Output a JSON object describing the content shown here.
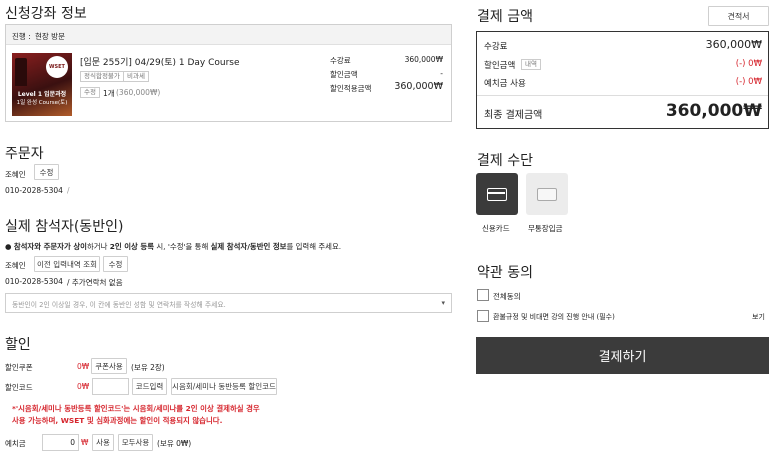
{
  "course_info": {
    "title": "신청강좌 정보",
    "status_label": "진행 :",
    "status_value": "현장 방문",
    "thumb_brand": "WSET",
    "thumb_line1": "Level 1 입문과정",
    "thumb_line2": "1일 완성 Course(토)",
    "course_name": "[입문 255기] 04/29(토) 1 Day Course",
    "tags": [
      "정식합정불가",
      "비과세"
    ],
    "edit_button": "수정",
    "quantity": "1개",
    "quantity_price": "(360,000₩)",
    "fee_label": "수강료",
    "fee_value": "360,000₩",
    "discount_label": "할인금액",
    "discount_value": "-",
    "applied_label": "할인적용금액",
    "applied_value": "360,000₩"
  },
  "orderer": {
    "title": "주문자",
    "name": "조혜인",
    "edit_button": "수정",
    "phone": "010-2028-5304",
    "separator": "/"
  },
  "attendee": {
    "title": "실제 참석자(동반인)",
    "notice_parts": [
      "● ",
      "참석자와 주문자가 상이",
      "하거나 ",
      "2인 이상 등록",
      " 시, '수정'을 통해 ",
      "실제 참석자/동반인 정보",
      "를 입력해 주세요."
    ],
    "name": "조혜인",
    "prev_button": "이전 입력내역 조회",
    "edit_button": "수정",
    "phone": "010-2028-5304",
    "extra_contact": "/  추가연락처 없음",
    "select_placeholder": "동반인이 2인 이상일 경우, 이 칸에 동반인 성함 및 연락처를 작성해 주세요."
  },
  "discount": {
    "title": "할인",
    "coupon_label": "할인쿠폰",
    "coupon_amount": "0₩",
    "coupon_button": "쿠폰사용",
    "coupon_have": "(보유 2장)",
    "code_label": "할인코드",
    "code_amount": "0₩",
    "code_input_value": "",
    "code_button": "코드입력",
    "seminar_button": "시음회/세미나 동반등록 할인코드",
    "warning_lines": [
      "*'시음회/세미나 동반등록 할인코드'는 시음회/세미나를 2인 이상 결제하실 경우",
      "사용 가능하며, WSET 및 심화과정에는 할인이 적용되지 않습니다."
    ],
    "deposit_label": "예치금",
    "deposit_value": "0",
    "deposit_unit": "₩",
    "use_button": "사용",
    "use_all_button": "모두사용",
    "deposit_have": "(보유 0₩)"
  },
  "payment": {
    "title": "결제 금액",
    "estimate_button": "견적서",
    "fee_label": "수강료",
    "fee_value": "360,000₩",
    "discount_label": "할인금액",
    "detail_badge": "내역",
    "discount_value": "(-) 0₩",
    "deposit_label": "예치금 사용",
    "deposit_value": "(-) 0₩",
    "final_label": "최종 결제금액",
    "final_value": "360,000₩"
  },
  "method": {
    "title": "결제 수단",
    "options": [
      "신용카드",
      "무통장입금"
    ],
    "selected": "신용카드"
  },
  "terms": {
    "title": "약관 동의",
    "all_label": "전체동의",
    "item_label": "환불규정 및 비대면 강의 진행 안내 (필수)",
    "view_link": "보기"
  },
  "pay_button": "결제하기",
  "colors": {
    "accent_red": "#d6262e",
    "pay_dark": "#3b3b3b"
  }
}
